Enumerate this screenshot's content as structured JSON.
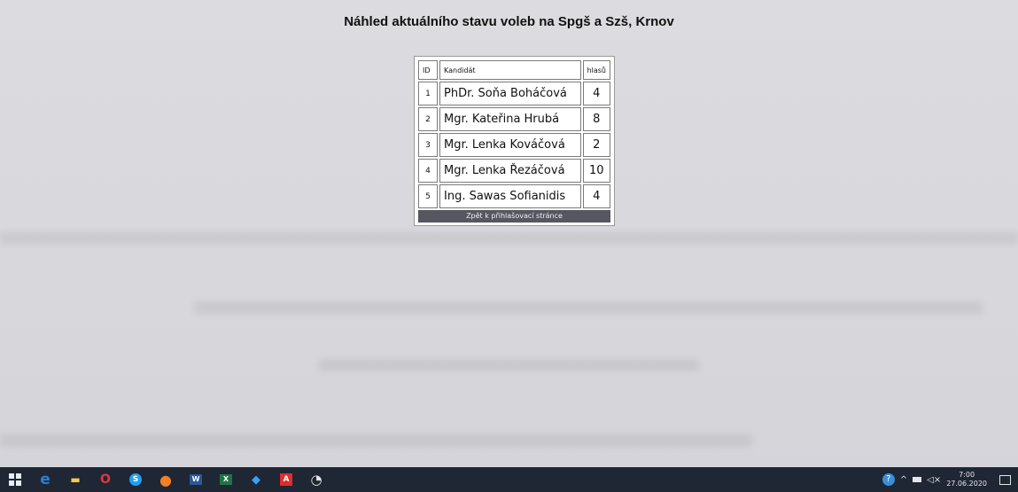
{
  "page": {
    "title": "Náhled aktuálního stavu voleb na Spgš a Szš, Krnov"
  },
  "table": {
    "headers": [
      "ID",
      "Kandidát",
      "hlasů"
    ],
    "rows": [
      {
        "id": "1",
        "name": "PhDr. Soňa Boháčová",
        "votes": "4"
      },
      {
        "id": "2",
        "name": "Mgr. Kateřina Hrubá",
        "votes": "8"
      },
      {
        "id": "3",
        "name": "Mgr. Lenka Kováčová",
        "votes": "2"
      },
      {
        "id": "4",
        "name": "Mgr. Lenka Řezáčová",
        "votes": "10"
      },
      {
        "id": "5",
        "name": "Ing. Sawas Sofianidis",
        "votes": "4"
      }
    ],
    "back_label": "Zpět k přihlašovací stránce"
  },
  "taskbar": {
    "icons": [
      {
        "name": "start-icon",
        "glyph": ""
      },
      {
        "name": "edge-icon",
        "glyph": "e",
        "color": "#2d7dd2"
      },
      {
        "name": "file-explorer-icon",
        "glyph": "▬",
        "color": "#f2c94c"
      },
      {
        "name": "opera-icon",
        "glyph": "O",
        "color": "#e4363b"
      },
      {
        "name": "skype-icon",
        "glyph": "S",
        "color": "#1da1f2"
      },
      {
        "name": "firefox-icon",
        "glyph": "●",
        "color": "#f48024"
      },
      {
        "name": "word-icon",
        "glyph": "W",
        "color": "#2b579a"
      },
      {
        "name": "excel-icon",
        "glyph": "X",
        "color": "#217346"
      },
      {
        "name": "store-icon",
        "glyph": "◆",
        "color": "#3aa0f3"
      },
      {
        "name": "acrobat-icon",
        "glyph": "A",
        "color": "#e12c2c"
      },
      {
        "name": "gauge-icon",
        "glyph": "◔",
        "color": "#e6e6e6"
      }
    ],
    "time": "7:00",
    "date": "27.06.2020"
  }
}
